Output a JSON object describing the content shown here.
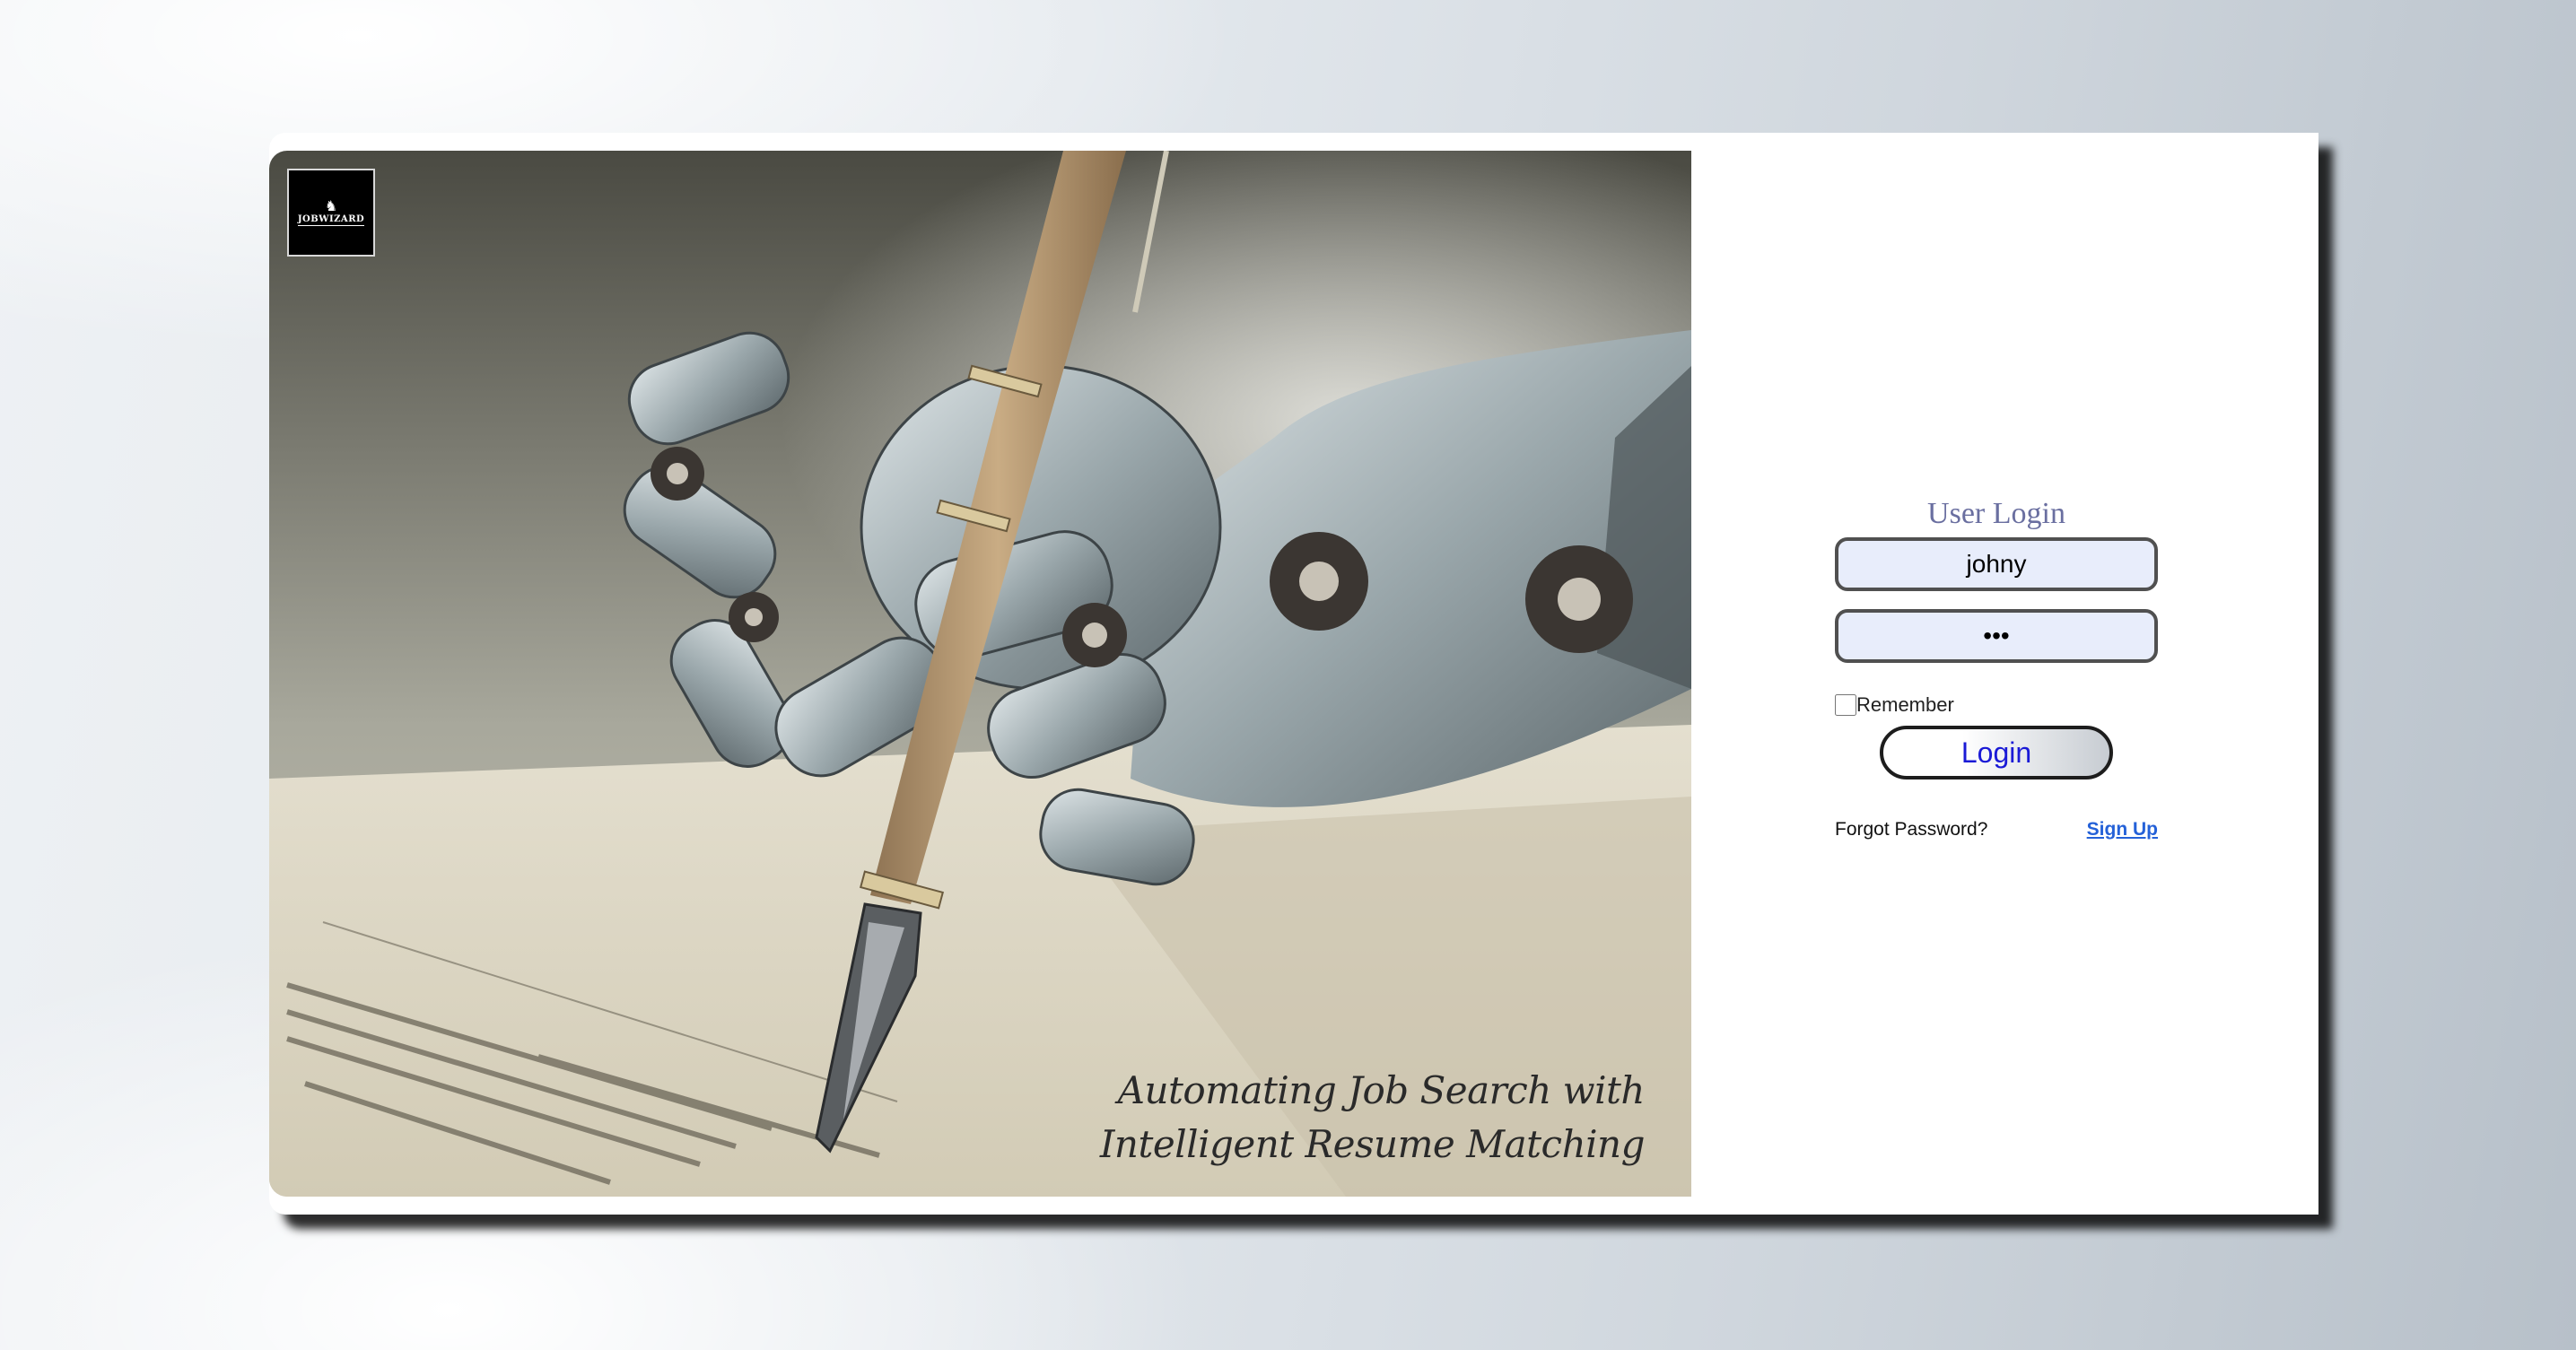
{
  "hero": {
    "logo_text": "JOBWIZARD",
    "tagline_line1": "Automating Job Search with",
    "tagline_line2": "Intelligent Resume Matching"
  },
  "login": {
    "title": "User Login",
    "username_value": "johny",
    "password_value": "•••",
    "remember_label": "Remember",
    "remember_checked": false,
    "login_button": "Login",
    "forgot_password": "Forgot Password?",
    "sign_up": "Sign Up"
  },
  "colors": {
    "title": "#6a6fa0",
    "field_background": "#e8edfb",
    "login_text": "#1a1ad6",
    "link": "#2461d8"
  },
  "icons": {
    "logo": "wizard-logo-icon"
  }
}
